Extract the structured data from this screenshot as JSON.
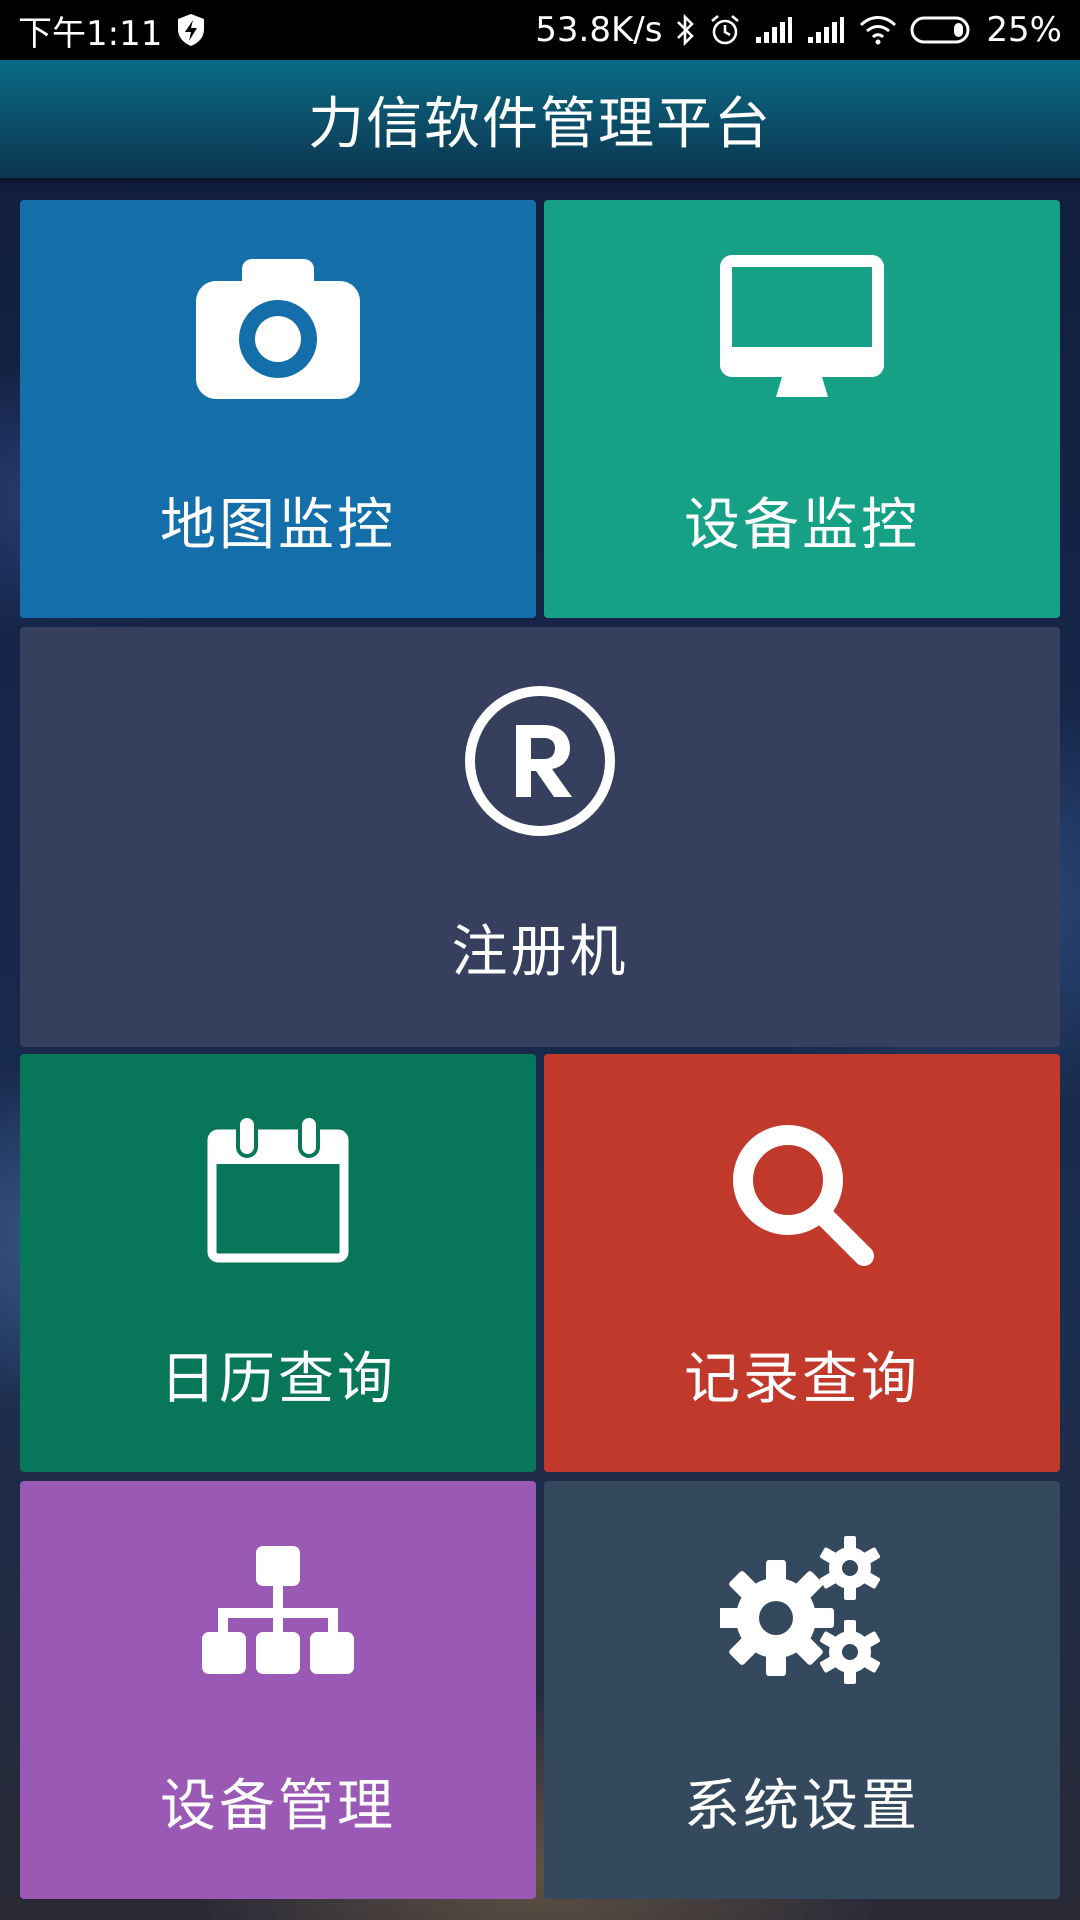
{
  "status_bar": {
    "time": "下午1:11",
    "net_speed": "53.8K/s",
    "battery": "25%"
  },
  "app_bar": {
    "title": "力信软件管理平台"
  },
  "tiles": [
    {
      "label": "地图监控",
      "icon": "camera-icon",
      "color": "#146ea9"
    },
    {
      "label": "设备监控",
      "icon": "monitor-icon",
      "color": "#16a085"
    },
    {
      "label": "注册机",
      "icon": "registered-icon",
      "color": "#363f5d"
    },
    {
      "label": "日历查询",
      "icon": "calendar-icon",
      "color": "#077659"
    },
    {
      "label": "记录查询",
      "icon": "search-icon",
      "color": "#c0392b"
    },
    {
      "label": "设备管理",
      "icon": "sitemap-icon",
      "color": "#9b59b6"
    },
    {
      "label": "系统设置",
      "icon": "gears-icon",
      "color": "#34495e"
    }
  ]
}
